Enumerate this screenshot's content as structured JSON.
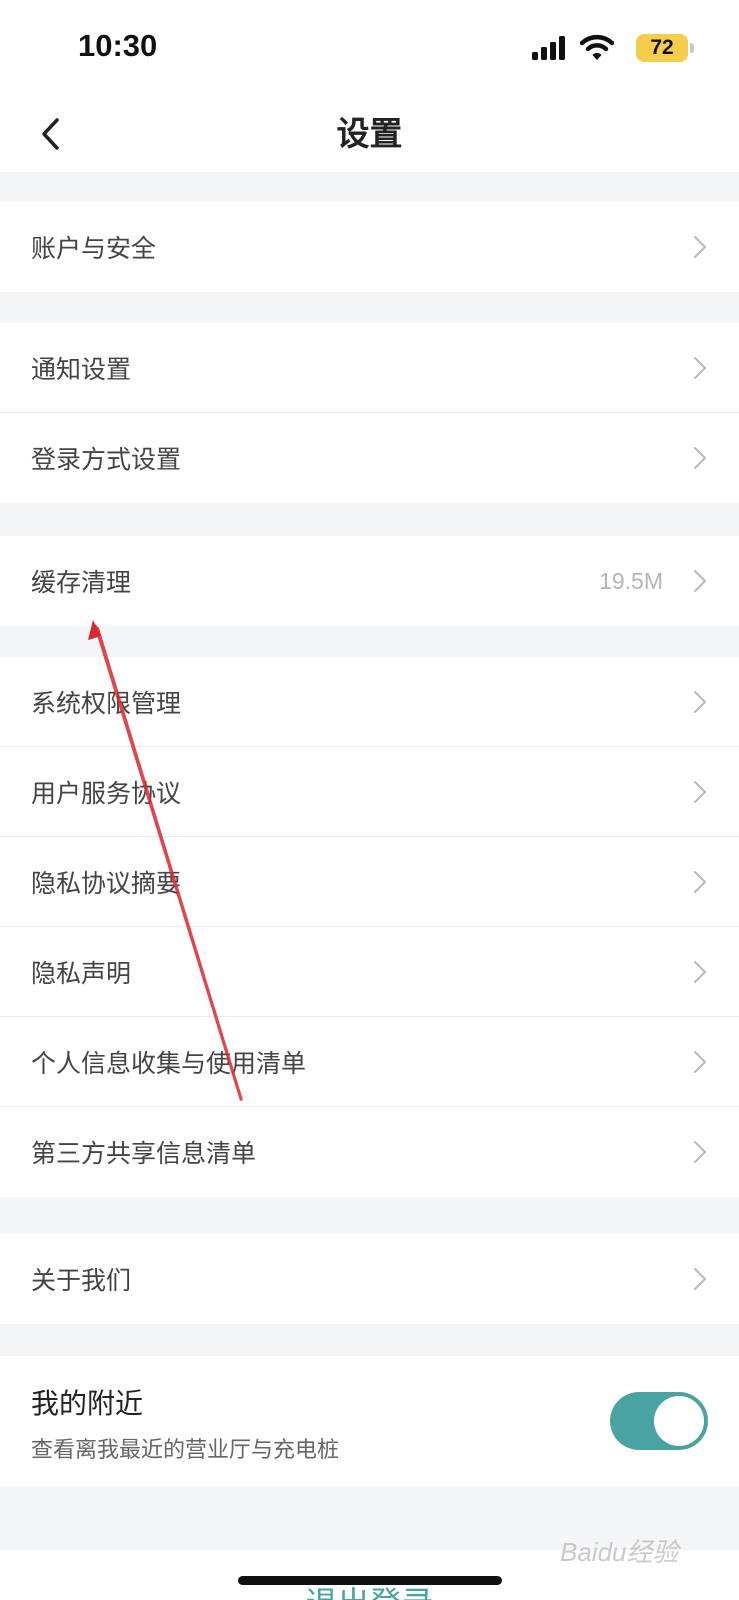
{
  "status_bar": {
    "time": "10:30",
    "battery_level": "72",
    "icons": [
      "signal-icon",
      "wifi-icon",
      "battery-icon"
    ]
  },
  "nav": {
    "title": "设置",
    "back_icon": "chevron-left-icon"
  },
  "groups": [
    {
      "items": [
        {
          "label": "账户与安全"
        }
      ]
    },
    {
      "items": [
        {
          "label": "通知设置"
        },
        {
          "label": "登录方式设置"
        }
      ]
    },
    {
      "items": [
        {
          "label": "缓存清理",
          "value": "19.5M"
        }
      ]
    },
    {
      "items": [
        {
          "label": "系统权限管理"
        },
        {
          "label": "用户服务协议"
        },
        {
          "label": "隐私协议摘要"
        },
        {
          "label": "隐私声明"
        },
        {
          "label": "个人信息收集与使用清单"
        },
        {
          "label": "第三方共享信息清单"
        }
      ]
    },
    {
      "items": [
        {
          "label": "关于我们"
        }
      ]
    }
  ],
  "nearby": {
    "title": "我的附近",
    "subtitle": "查看离我最近的营业厅与充电桩",
    "enabled": true
  },
  "logout_label": "退出登录",
  "watermark_text": "Baidu经验",
  "colors": {
    "accent": "#4aa3a3",
    "annotation_arrow": "#d9272e",
    "battery": "#f5cd4a",
    "background": "#f4f5f7"
  }
}
